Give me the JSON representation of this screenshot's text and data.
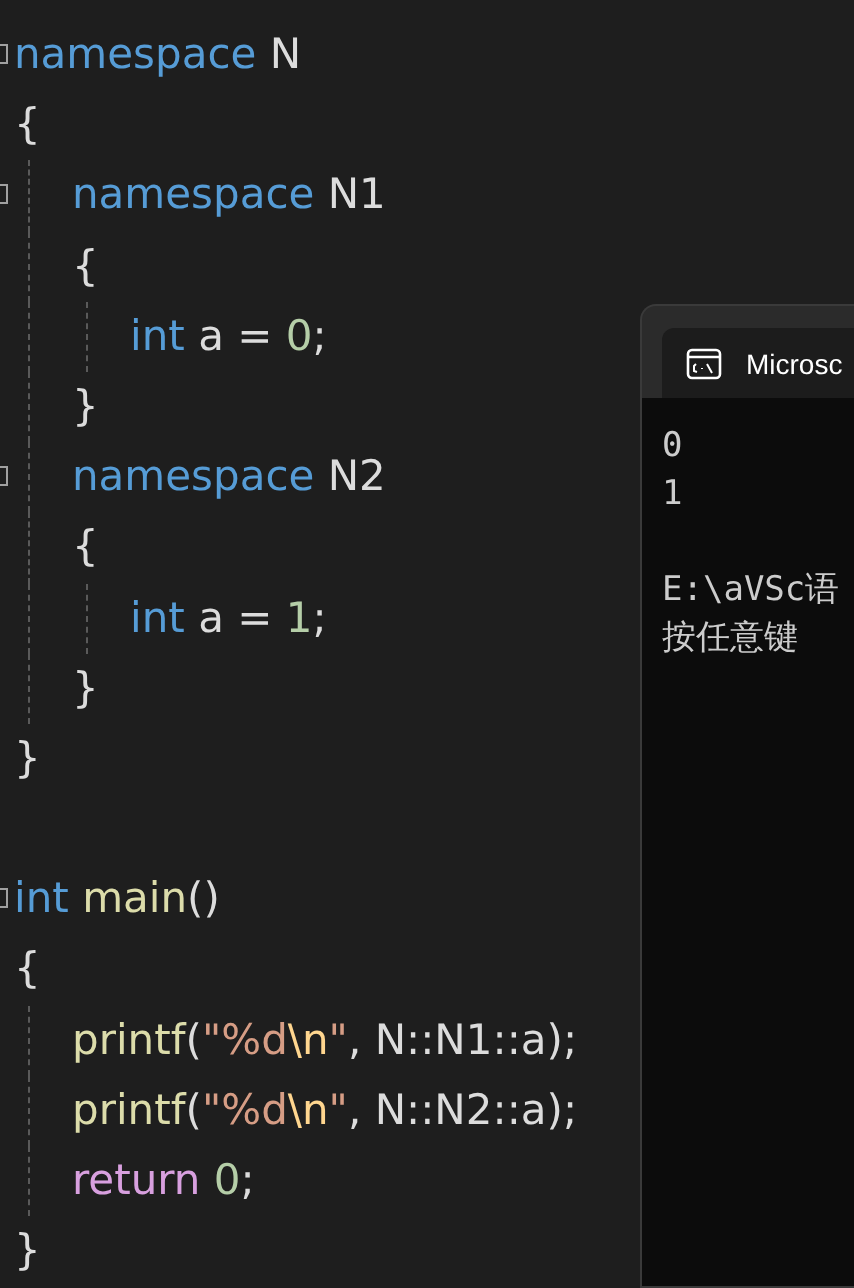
{
  "editor": {
    "blocks": [
      {
        "lines": [
          {
            "foldable": true,
            "tokens": [
              {
                "kind": "keyword",
                "text": "namespace"
              },
              {
                "kind": "plain",
                "text": " N"
              }
            ]
          },
          {
            "foldable": false,
            "tokens": [
              {
                "kind": "plain",
                "text": "{"
              }
            ],
            "children": [
              {
                "foldable": true,
                "tokens": [
                  {
                    "kind": "keyword",
                    "text": "namespace"
                  },
                  {
                    "kind": "plain",
                    "text": " N1"
                  }
                ]
              },
              {
                "foldable": false,
                "tokens": [
                  {
                    "kind": "plain",
                    "text": "{"
                  }
                ],
                "children": [
                  {
                    "foldable": false,
                    "tokens": [
                      {
                        "kind": "keyword",
                        "text": "int"
                      },
                      {
                        "kind": "plain",
                        "text": " a = "
                      },
                      {
                        "kind": "number",
                        "text": "0"
                      },
                      {
                        "kind": "plain",
                        "text": ";"
                      }
                    ]
                  }
                ]
              },
              {
                "foldable": false,
                "tokens": [
                  {
                    "kind": "plain",
                    "text": "}"
                  }
                ]
              },
              {
                "foldable": true,
                "tokens": [
                  {
                    "kind": "keyword",
                    "text": "namespace"
                  },
                  {
                    "kind": "plain",
                    "text": " N2"
                  }
                ]
              },
              {
                "foldable": false,
                "tokens": [
                  {
                    "kind": "plain",
                    "text": "{"
                  }
                ],
                "children": [
                  {
                    "foldable": false,
                    "tokens": [
                      {
                        "kind": "keyword",
                        "text": "int"
                      },
                      {
                        "kind": "plain",
                        "text": " a = "
                      },
                      {
                        "kind": "number",
                        "text": "1"
                      },
                      {
                        "kind": "plain",
                        "text": ";"
                      }
                    ]
                  }
                ]
              },
              {
                "foldable": false,
                "tokens": [
                  {
                    "kind": "plain",
                    "text": "}"
                  }
                ]
              }
            ]
          },
          {
            "foldable": false,
            "tokens": [
              {
                "kind": "plain",
                "text": "}"
              }
            ]
          }
        ]
      },
      {
        "lines": [
          {
            "foldable": true,
            "tokens": [
              {
                "kind": "keyword",
                "text": "int"
              },
              {
                "kind": "function",
                "text": " main"
              },
              {
                "kind": "plain",
                "text": "()"
              }
            ]
          },
          {
            "foldable": false,
            "tokens": [
              {
                "kind": "plain",
                "text": "{"
              }
            ],
            "children": [
              {
                "foldable": false,
                "tokens": [
                  {
                    "kind": "function",
                    "text": "printf"
                  },
                  {
                    "kind": "plain",
                    "text": "("
                  },
                  {
                    "kind": "string",
                    "text": "\"%d"
                  },
                  {
                    "kind": "escape",
                    "text": "\\n"
                  },
                  {
                    "kind": "string",
                    "text": "\""
                  },
                  {
                    "kind": "plain",
                    "text": ", N::N1::a);"
                  }
                ]
              },
              {
                "foldable": false,
                "tokens": [
                  {
                    "kind": "function",
                    "text": "printf"
                  },
                  {
                    "kind": "plain",
                    "text": "("
                  },
                  {
                    "kind": "string",
                    "text": "\"%d"
                  },
                  {
                    "kind": "escape",
                    "text": "\\n"
                  },
                  {
                    "kind": "string",
                    "text": "\""
                  },
                  {
                    "kind": "plain",
                    "text": ", N::N2::a);"
                  }
                ]
              },
              {
                "foldable": false,
                "tokens": [
                  {
                    "kind": "control",
                    "text": "return"
                  },
                  {
                    "kind": "number",
                    "text": " 0"
                  },
                  {
                    "kind": "plain",
                    "text": ";"
                  }
                ]
              }
            ]
          },
          {
            "foldable": false,
            "tokens": [
              {
                "kind": "plain",
                "text": "}"
              }
            ]
          }
        ]
      }
    ]
  },
  "console": {
    "tab_title": "Microsc",
    "output": [
      {
        "lines": [
          "0",
          "1"
        ]
      },
      {
        "lines": [
          "E:\\aVSc语",
          "按任意键"
        ]
      }
    ]
  }
}
